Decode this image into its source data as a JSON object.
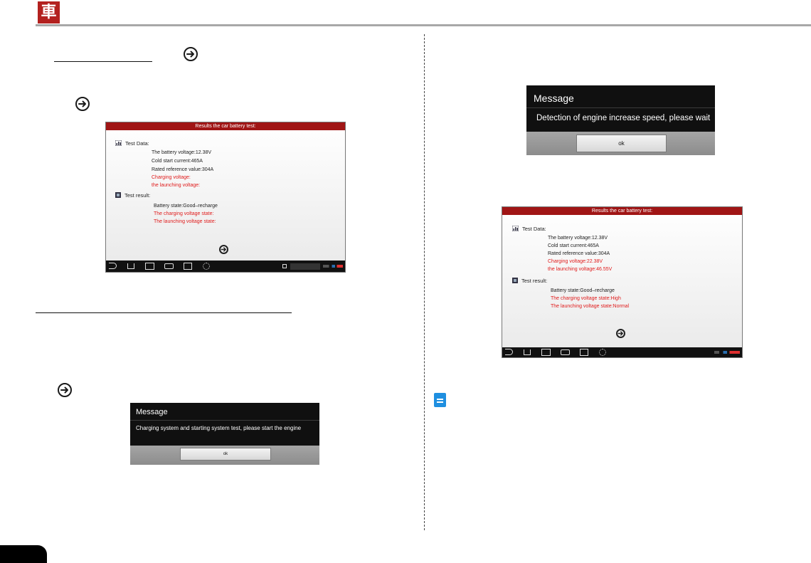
{
  "header": {
    "logo_glyph": "車"
  },
  "shot_a": {
    "title": "Results the car battery test:",
    "test_data_label": "Test Data:",
    "data_lines": [
      "The battery voltage:12.38V",
      "Cold start current:465A",
      "Rated reference value:304A",
      "Charging voltage:",
      "the launching voltage:"
    ],
    "test_result_label": "Test result:",
    "result_lines": [
      "Battery state:Good–recharge",
      "The charging voltage state:",
      "The launching voltage state:"
    ]
  },
  "shot_b": {
    "title": "Results the car battery test:",
    "test_data_label": "Test Data:",
    "data_lines": [
      "The battery voltage:12.38V",
      "Cold start current:465A",
      "Rated reference value:304A",
      "Charging voltage:22.38V",
      "the launching voltage:46.55V"
    ],
    "test_result_label": "Test result:",
    "result_lines": [
      "Battery state:Good–recharge",
      "The charging voltage state:High",
      "The launching voltage state:Normal"
    ]
  },
  "dialog_engine": {
    "title": "Message",
    "message": "Charging system and starting system test, please start the engine",
    "ok_label": "ok"
  },
  "dialog_speed": {
    "title": "Message",
    "message": "Detection of engine increase speed, please wait",
    "ok_label": "ok"
  },
  "colors": {
    "title_bar": "#a01515",
    "logo": "#b3211f",
    "red_text": "#e01b1b",
    "note_icon": "#1f8fe0"
  },
  "icons": [
    "next-arrow-icon",
    "chart-icon",
    "result-icon",
    "back-icon",
    "home-icon",
    "recent-apps-icon",
    "print-icon",
    "screenshot-icon",
    "settings-icon",
    "note-icon"
  ]
}
